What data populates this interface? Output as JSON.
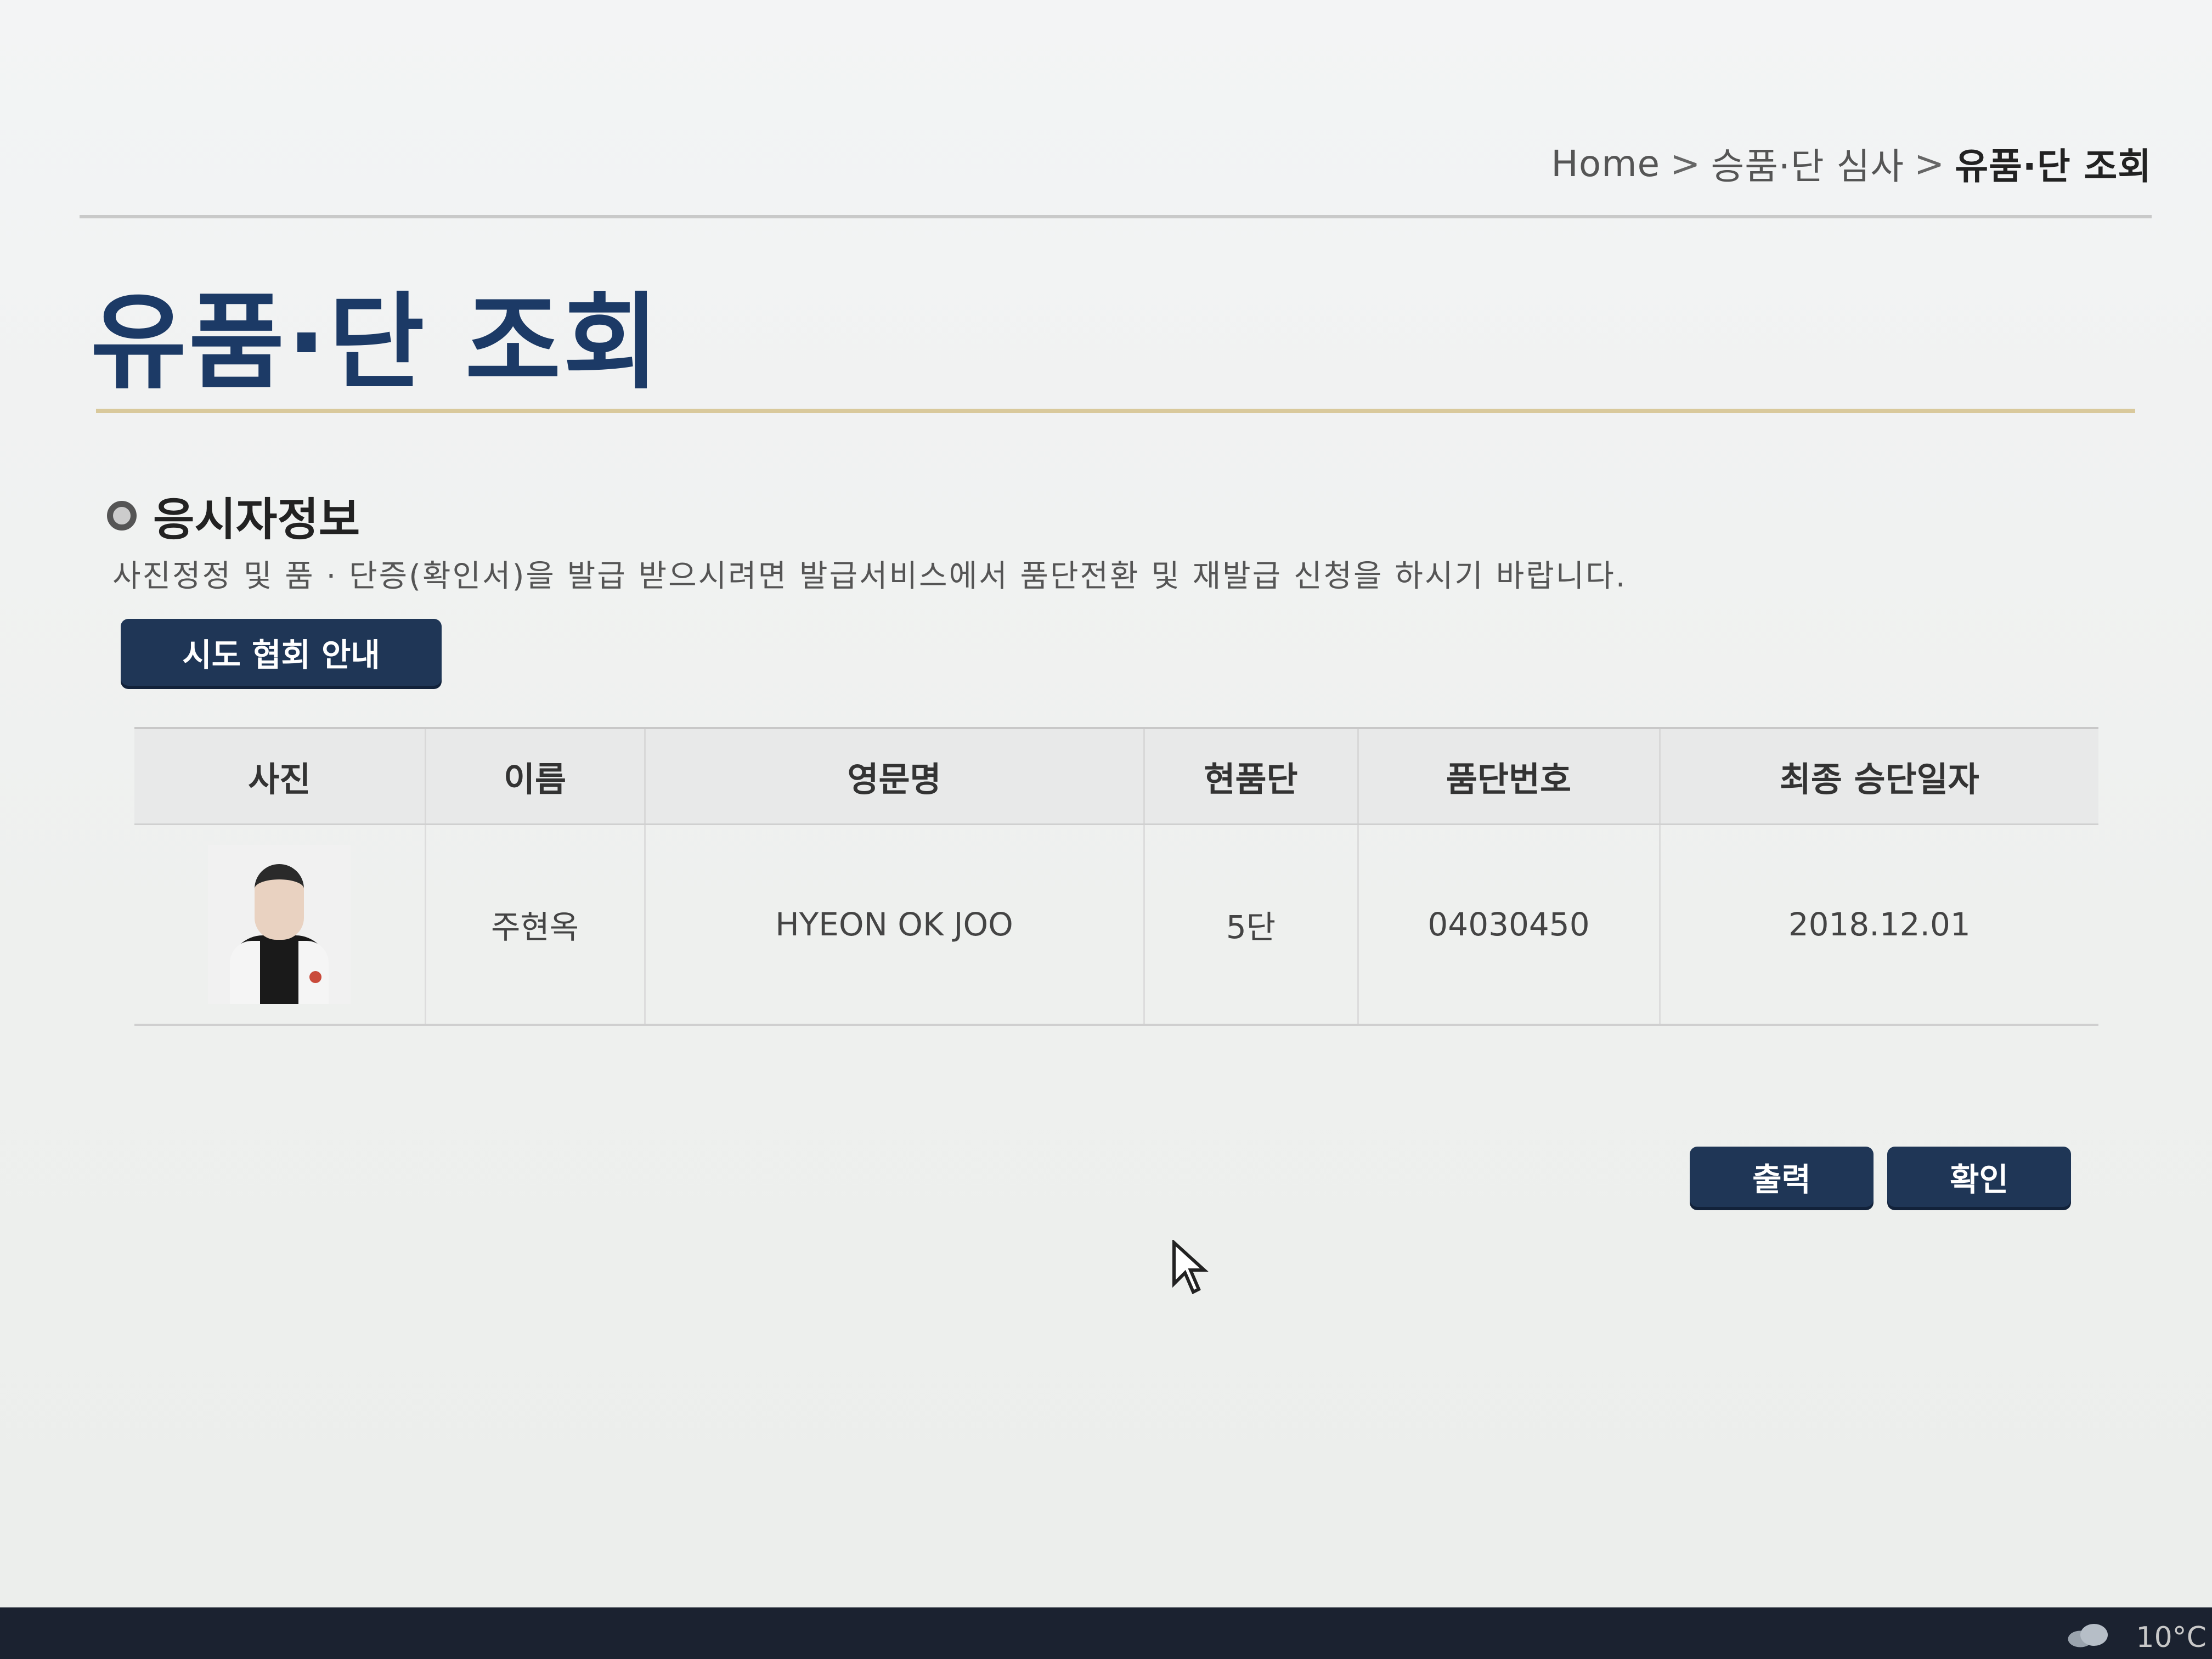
{
  "breadcrumb": {
    "home": "Home",
    "separator": ">",
    "level1": "승품·단 심사",
    "current": "유품·단 조회"
  },
  "page_title": "유품·단 조회",
  "section": {
    "title": "응시자정보",
    "notice": "사진정정 및 품 · 단증(확인서)을 발급 받으시려면 발급서비스에서 품단전환 및 재발급 신청을 하시기 바랍니다."
  },
  "buttons": {
    "guide": "시도 협회 안내",
    "print": "출력",
    "confirm": "확인"
  },
  "table": {
    "headers": [
      "사진",
      "이름",
      "영문명",
      "현품단",
      "품단번호",
      "최종 승단일자"
    ],
    "rows": [
      {
        "name": "주현옥",
        "english_name": "HYEON OK JOO",
        "rank": "5단",
        "rank_number": "04030450",
        "last_promotion_date": "2018.12.01"
      }
    ]
  },
  "taskbar": {
    "temperature": "10°C",
    "weather_icon": "cloud-icon"
  }
}
